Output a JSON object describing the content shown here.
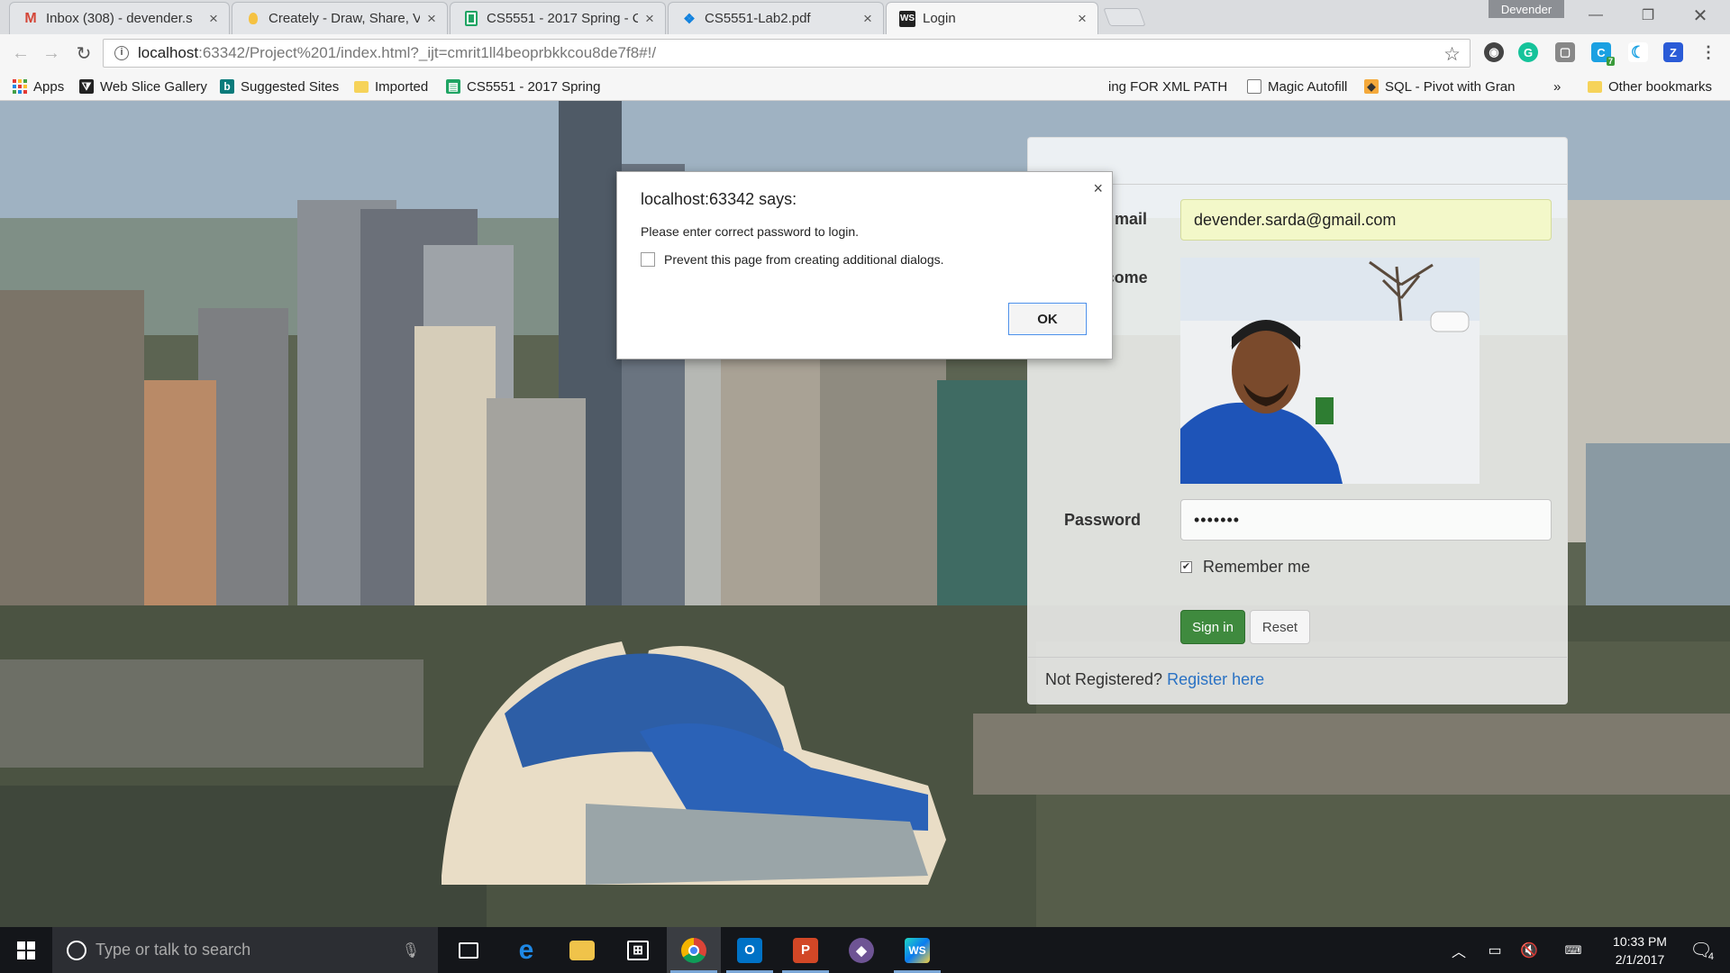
{
  "browser": {
    "tabs": [
      {
        "title": "Inbox (308) - devender.s",
        "icon": "gmail-icon",
        "active": false
      },
      {
        "title": "Creately - Draw, Share, V",
        "icon": "creately-icon",
        "active": false
      },
      {
        "title": "CS5551 - 2017 Spring - C",
        "icon": "sheets-icon",
        "active": false
      },
      {
        "title": "CS5551-Lab2.pdf",
        "icon": "dropbox-icon",
        "active": false
      },
      {
        "title": "Login",
        "icon": "webstorm-icon",
        "active": true
      }
    ],
    "profile_name": "Devender",
    "url_host": "localhost",
    "url_rest": ":63342/Project%201/index.html?_ijt=cmrit1ll4beoprbkkcou8de7f8#!/",
    "bookmarks": [
      {
        "label": "Apps",
        "icon": "apps-grid-icon"
      },
      {
        "label": "Web Slice Gallery",
        "icon": "web-slice-icon"
      },
      {
        "label": "Suggested Sites",
        "icon": "bing-icon"
      },
      {
        "label": "Imported",
        "icon": "folder-icon"
      },
      {
        "label": "CS5551 - 2017 Spring",
        "icon": "sheets-icon"
      },
      {
        "label": "ing FOR XML PATH",
        "icon": "none"
      },
      {
        "label": "Magic Autofill",
        "icon": "page-icon"
      },
      {
        "label": "SQL - Pivot with Gran",
        "icon": "sql-icon"
      },
      {
        "label": "»",
        "icon": "none"
      },
      {
        "label": "Other bookmarks",
        "icon": "folder-icon"
      }
    ]
  },
  "login": {
    "email_label": "mail",
    "email_value": "devender.sarda@gmail.com",
    "welcome_label": "Welcome",
    "password_label": "Password",
    "password_value": "•••••••",
    "remember_label": "Remember me",
    "remember_checked": true,
    "signin_label": "Sign in",
    "reset_label": "Reset",
    "footer_text": "Not Registered? ",
    "register_link": "Register here"
  },
  "dialog": {
    "title": "localhost:63342 says:",
    "message": "Please enter correct password to login.",
    "prevent_label": "Prevent this page from creating additional dialogs.",
    "ok_label": "OK",
    "close_glyph": "×"
  },
  "taskbar": {
    "search_placeholder": "Type or talk to search",
    "time": "10:33 PM",
    "date": "2/1/2017",
    "notification_count": "4",
    "extension_badge": "7"
  },
  "colors": {
    "signin_green": "#3f8a3e",
    "link_blue": "#2a72c4",
    "autofill_yellow": "#f3f8c9",
    "taskbar": "#14161a"
  }
}
